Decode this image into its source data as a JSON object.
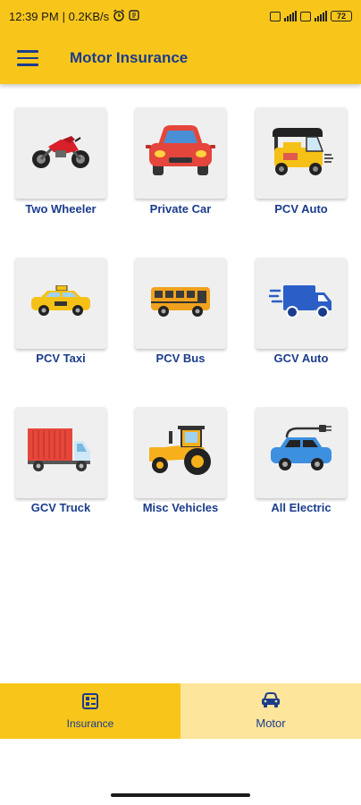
{
  "status_bar": {
    "time": "12:39 PM",
    "network_speed": "| 0.2KB/s",
    "battery": "72"
  },
  "app_bar": {
    "title": "Motor Insurance",
    "menu_icon": "hamburger-menu-icon"
  },
  "vehicles": [
    {
      "label": "Two Wheeler",
      "icon": "motorcycle-icon"
    },
    {
      "label": "Private Car",
      "icon": "car-front-icon"
    },
    {
      "label": "PCV Auto",
      "icon": "auto-rickshaw-icon"
    },
    {
      "label": "PCV Taxi",
      "icon": "taxi-icon"
    },
    {
      "label": "PCV Bus",
      "icon": "bus-icon"
    },
    {
      "label": "GCV Auto",
      "icon": "delivery-truck-icon"
    },
    {
      "label": "GCV Truck",
      "icon": "truck-icon"
    },
    {
      "label": "Misc Vehicles",
      "icon": "tractor-icon"
    },
    {
      "label": "All Electric",
      "icon": "electric-car-icon"
    }
  ],
  "bottom_nav": {
    "items": [
      {
        "label": "Insurance",
        "icon": "insurance-list-icon",
        "active": true
      },
      {
        "label": "Motor",
        "icon": "car-icon",
        "active": false
      }
    ]
  },
  "colors": {
    "brand_yellow": "#f8c61b",
    "light_yellow": "#fde59b",
    "brand_blue": "#1b3c8c",
    "tile_bg": "#efefef"
  }
}
